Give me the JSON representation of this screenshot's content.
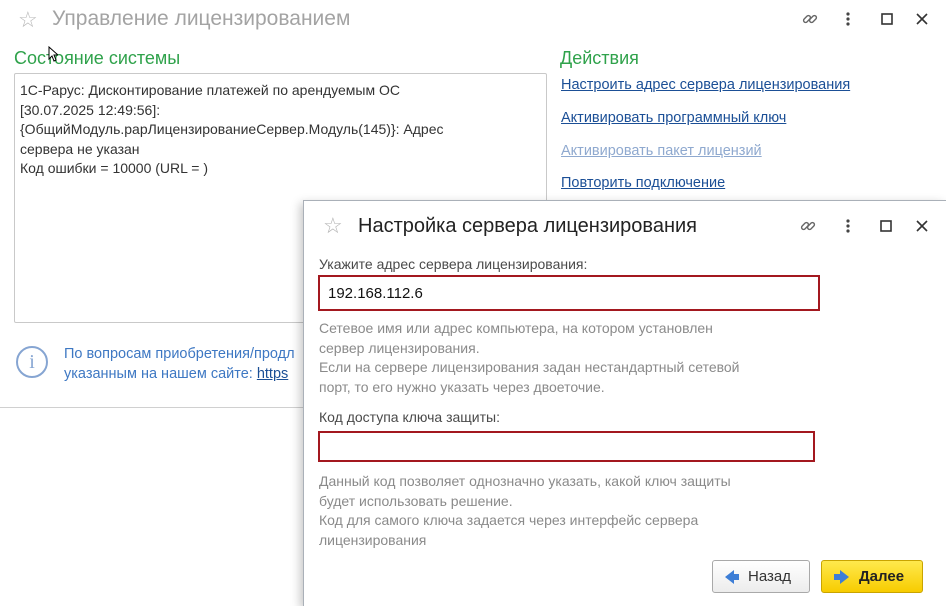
{
  "main_window": {
    "title": "Управление лицензированием",
    "system_state_title": "Состояние системы",
    "system_state_text": "1С-Рарус: Дисконтирование платежей по арендуемым ОС\n[30.07.2025 12:49:56]:\n{ОбщийМодуль.рарЛицензированиеСервер.Модуль(145)}: Адрес\nсервера не указан\nКод ошибки = 10000 (URL = )",
    "actions_title": "Действия",
    "actions": [
      {
        "label": "Настроить адрес сервера лицензирования",
        "enabled": true
      },
      {
        "label": "Активировать программный ключ",
        "enabled": true
      },
      {
        "label": "Активировать пакет лицензий",
        "enabled": false
      },
      {
        "label": "Повторить подключение",
        "enabled": true
      }
    ],
    "info_line1": "По вопросам приобретения/продл",
    "info_line2": "указанным на нашем сайте: ",
    "info_link": "https"
  },
  "dialog": {
    "title": "Настройка сервера лицензирования",
    "server_label": "Укажите адрес сервера лицензирования:",
    "server_value": "192.168.112.6",
    "server_hint": "Сетевое имя или адрес компьютера, на котором установлен\nсервер лицензирования.\nЕсли на сервере лицензирования задан нестандартный сетевой\nпорт, то его нужно указать через двоеточие.",
    "code_label": "Код доступа ключа защиты:",
    "code_value": "",
    "code_hint": "Данный код позволяет однозначно указать, какой ключ защиты\nбудет использовать решение.\nКод для самого ключа задается через интерфейс сервера\nлицензирования",
    "back_label": "Назад",
    "next_label": "Далее"
  },
  "colors": {
    "green_heading": "#2fa24b",
    "link": "#1b4f96",
    "invalid_border": "#a3181f",
    "primary_button": "#f7cc00"
  },
  "icons": [
    "star-icon",
    "link-icon",
    "more-icon",
    "maximize-icon",
    "close-icon",
    "info-icon",
    "arrow-left-icon",
    "arrow-right-icon"
  ]
}
